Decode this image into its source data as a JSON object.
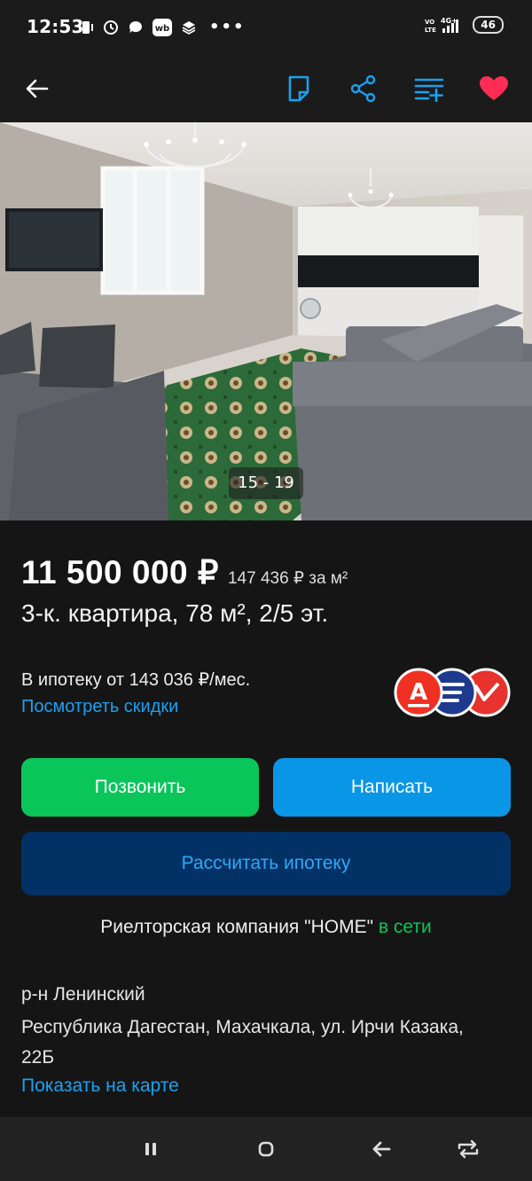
{
  "status_bar": {
    "time": "12:53",
    "wb_label": "wb",
    "network": "4G+",
    "volte": "Vo LTE",
    "battery": "46"
  },
  "toolbar": {
    "back_icon": "arrow-left-icon",
    "note_icon": "note-icon",
    "share_icon": "share-icon",
    "compare_icon": "compare-list-icon",
    "favorite_icon": "heart-icon",
    "accent_color": "#1aa1ef",
    "favorite_color": "#ff2d55"
  },
  "gallery": {
    "counter": "15 - 19"
  },
  "listing": {
    "price": "11 500 000 ₽",
    "price_per_m2": "147 436 ₽ за м²",
    "title": "3-к. квартира, 78 м², 2/5 эт."
  },
  "mortgage": {
    "text": "В ипотеку от 143 036 ₽/мес.",
    "discount_link": "Посмотреть скидки",
    "bank_logos": {
      "alfa_letter": "А",
      "colors": [
        "#ef3124",
        "#1d3a8f",
        "#e7322d"
      ]
    }
  },
  "actions": {
    "call": "Позвонить",
    "write": "Написать",
    "calculate": "Рассчитать ипотеку"
  },
  "seller": {
    "name": "Риелторская компания \"HOME\"",
    "status": "в сети"
  },
  "location": {
    "district": "р-н Ленинский",
    "address": "Республика Дагестан, Махачкала, ул. Ирчи Казака, 22Б",
    "map_link": "Показать на карте"
  }
}
